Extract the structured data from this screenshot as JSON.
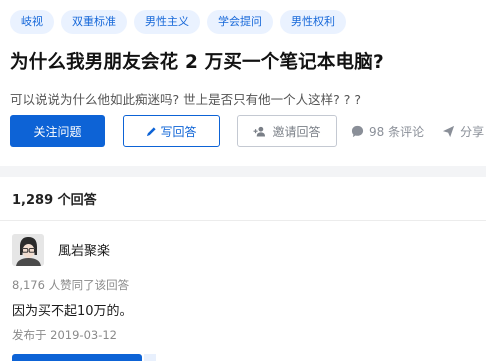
{
  "tags": [
    "岐视",
    "双重标准",
    "男性主义",
    "学会提问",
    "男性权利"
  ],
  "question": {
    "title": "为什么我男朋友会花 2 万买一个笔记本电脑?",
    "detail": "可以说说为什么他如此痴迷吗? 世上是否只有他一个人这样? ? ?"
  },
  "actions": {
    "follow_label": "关注问题",
    "write_label": "写回答",
    "invite_label": "邀请回答",
    "comment_label": "98 条评论",
    "share_label": "分享"
  },
  "answers": {
    "count_label": "1,289 个回答",
    "items": [
      {
        "author": "風岩聚楽",
        "votes": "8,176 人赞同了该回答",
        "text": "因为买不起10万的。",
        "published": "发布于 2019-03-12"
      }
    ]
  },
  "colors": {
    "accent": "#0d63d6",
    "tag_bg": "#eaf2ff",
    "tag_text": "#1768d9",
    "muted": "#8a8f98"
  },
  "icons": [
    "pencil-icon",
    "add-person-icon",
    "comment-icon",
    "share-icon"
  ]
}
